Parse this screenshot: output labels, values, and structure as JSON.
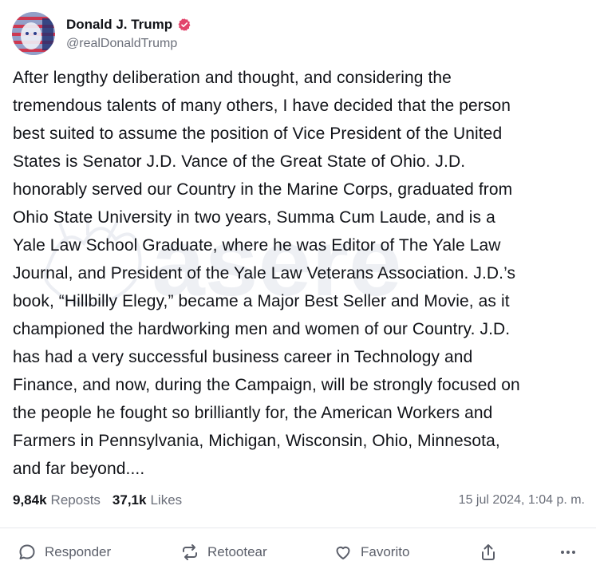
{
  "author": {
    "display_name": "Donald J. Trump",
    "handle": "@realDonaldTrump",
    "verified_color": "#e2456c"
  },
  "post": {
    "text": "After lengthy deliberation and thought, and considering the\ntremendous talents of many others, I have decided that the person\nbest suited to assume the position of Vice President of the United\nStates is Senator J.D. Vance of the Great State of Ohio. J.D.\nhonorably served our Country in the Marine Corps, graduated from\nOhio State University in two years, Summa Cum Laude, and is a\nYale Law School Graduate, where he was Editor of The Yale Law\nJournal, and President of the Yale Law Veterans Association. J.D.’s\nbook, “Hillbilly Elegy,” became a Major Best Seller and Movie, as it\nchampioned the hardworking men and women of our Country. J.D.\nhas had a very successful business career in Technology and\nFinance, and now, during the Campaign, will be strongly focused on\nthe people he fought so brilliantly for, the American Workers and\nFarmers in Pennsylvania, Michigan, Wisconsin, Ohio, Minnesota,\nand far beyond...."
  },
  "stats": {
    "reposts_count": "9,84k",
    "reposts_label": "Reposts",
    "likes_count": "37,1k",
    "likes_label": "Likes",
    "timestamp": "15 jul 2024, 1:04 p. m."
  },
  "actions": {
    "reply_label": "Responder",
    "retweet_label": "Retootear",
    "favorite_label": "Favorito",
    "share_icon": "share-icon",
    "more_icon": "more-icon"
  },
  "watermark": {
    "text": "asere"
  }
}
